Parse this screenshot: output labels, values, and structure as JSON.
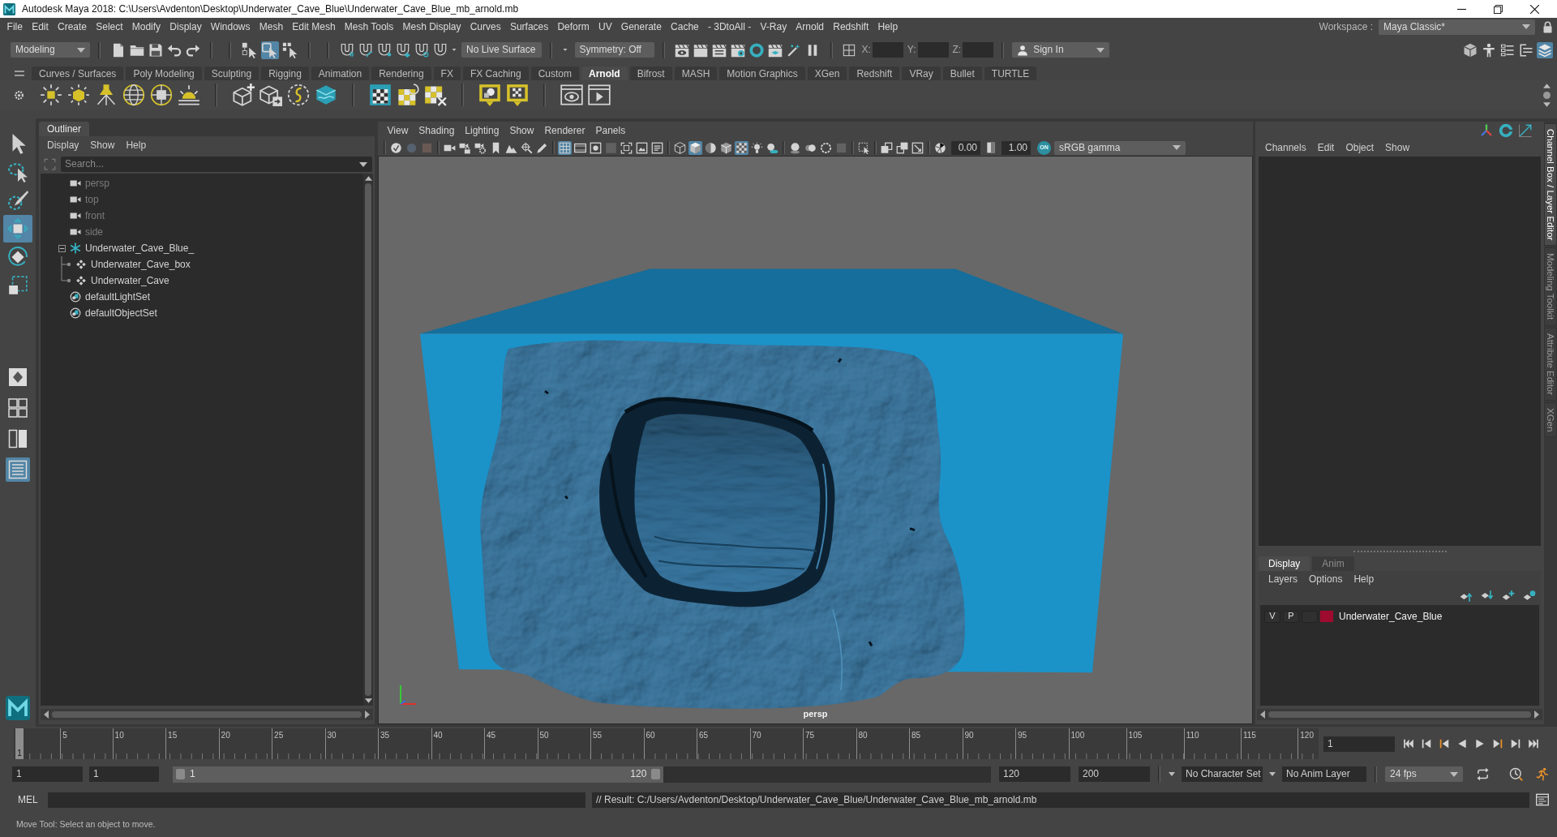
{
  "window": {
    "title": "Autodesk Maya 2018: C:\\Users\\Avdenton\\Desktop\\Underwater_Cave_Blue\\Underwater_Cave_Blue_mb_arnold.mb"
  },
  "menu_bar": {
    "items": [
      "File",
      "Edit",
      "Create",
      "Select",
      "Modify",
      "Display",
      "Windows",
      "Mesh",
      "Edit Mesh",
      "Mesh Tools",
      "Mesh Display",
      "Curves",
      "Surfaces",
      "Deform",
      "UV",
      "Generate",
      "Cache",
      "- 3DtoAll -",
      "V-Ray",
      "Arnold",
      "Redshift",
      "Help"
    ],
    "workspace_label": "Workspace :",
    "workspace": "Maya Classic*"
  },
  "status_line": {
    "menu_set": "Modeling",
    "select_modes": [
      {
        "selected": false
      },
      {
        "selected": true
      },
      {
        "selected": false
      }
    ],
    "live_surface": "No Live Surface",
    "symmetry": "Symmetry: Off",
    "coordinates": [
      {
        "label": "X:"
      },
      {
        "label": "Y:"
      },
      {
        "label": "Z:"
      }
    ],
    "sign_in": "Sign In",
    "panel_toggles": [
      {
        "selected": false
      },
      {
        "selected": false
      },
      {
        "selected": false
      },
      {
        "selected": false
      },
      {
        "selected": true
      }
    ]
  },
  "shelf": {
    "tabs": [
      {
        "label": "Curves / Surfaces",
        "selected": false
      },
      {
        "label": "Poly Modeling",
        "selected": false
      },
      {
        "label": "Sculpting",
        "selected": false
      },
      {
        "label": "Rigging",
        "selected": false
      },
      {
        "label": "Animation",
        "selected": false
      },
      {
        "label": "Rendering",
        "selected": false
      },
      {
        "label": "FX",
        "selected": false
      },
      {
        "label": "FX Caching",
        "selected": false
      },
      {
        "label": "Custom",
        "selected": false
      },
      {
        "label": "Arnold",
        "selected": true
      },
      {
        "label": "Bifrost",
        "selected": false
      },
      {
        "label": "MASH",
        "selected": false
      },
      {
        "label": "Motion Graphics",
        "selected": false
      },
      {
        "label": "XGen",
        "selected": false
      },
      {
        "label": "Redshift",
        "selected": false
      },
      {
        "label": "VRay",
        "selected": false
      },
      {
        "label": "Bullet",
        "selected": false
      },
      {
        "label": "TURTLE",
        "selected": false
      }
    ]
  },
  "toolbox": {
    "tools": [
      {
        "selected": false
      },
      {
        "selected": false
      },
      {
        "selected": false
      },
      {
        "selected": true
      },
      {
        "selected": false
      },
      {
        "selected": false
      }
    ],
    "layouts": [
      {
        "selected": false
      },
      {
        "selected": false
      },
      {
        "selected": false
      },
      {
        "selected": true
      }
    ]
  },
  "outliner": {
    "tab": "Outliner",
    "menus": [
      "Display",
      "Show",
      "Help"
    ],
    "search": {
      "placeholder": "Search..."
    },
    "items": [
      {
        "label": "persp",
        "kind": "camera",
        "dimmed": true,
        "selected": false
      },
      {
        "label": "top",
        "kind": "camera",
        "dimmed": true,
        "selected": false
      },
      {
        "label": "front",
        "kind": "camera",
        "dimmed": true,
        "selected": false
      },
      {
        "label": "side",
        "kind": "camera",
        "dimmed": true,
        "selected": false
      },
      {
        "label": "Underwater_Cave_Blue_",
        "kind": "group",
        "dimmed": false,
        "selected": false,
        "expanded": true,
        "children": [
          {
            "label": "Underwater_Cave_box",
            "kind": "mesh",
            "dimmed": false,
            "selected": false
          },
          {
            "label": "Underwater_Cave",
            "kind": "mesh",
            "dimmed": false,
            "selected": false
          }
        ]
      },
      {
        "label": "defaultLightSet",
        "kind": "set",
        "dimmed": false,
        "selected": false
      },
      {
        "label": "defaultObjectSet",
        "kind": "set",
        "dimmed": false,
        "selected": false
      }
    ]
  },
  "viewport": {
    "menus": [
      "View",
      "Shading",
      "Lighting",
      "Show",
      "Renderer",
      "Panels"
    ],
    "toolbar": [
      {
        "selected": false,
        "disabled": false
      },
      {
        "selected": false,
        "disabled": true
      },
      {
        "selected": false,
        "disabled": true
      },
      {
        "selected": false,
        "disabled": false
      },
      {
        "selected": false,
        "disabled": false
      },
      {
        "selected": false,
        "disabled": false
      },
      {
        "selected": false,
        "disabled": false
      },
      {
        "selected": false,
        "disabled": false
      },
      {
        "selected": false,
        "disabled": false
      },
      {
        "selected": false,
        "disabled": false
      },
      {
        "selected": true,
        "disabled": false
      },
      {
        "selected": false,
        "disabled": false
      },
      {
        "selected": false,
        "disabled": false
      },
      {
        "selected": false,
        "disabled": true
      },
      {
        "selected": false,
        "disabled": false
      },
      {
        "selected": false,
        "disabled": false
      },
      {
        "selected": false,
        "disabled": false
      },
      {
        "selected": false,
        "disabled": false
      },
      {
        "selected": true,
        "disabled": false
      },
      {
        "selected": false,
        "disabled": false
      },
      {
        "selected": false,
        "disabled": false
      },
      {
        "selected": true,
        "disabled": false
      },
      {
        "selected": false,
        "disabled": false
      },
      {
        "selected": false,
        "disabled": false
      },
      {
        "selected": false,
        "disabled": false
      },
      {
        "selected": false,
        "disabled": false
      },
      {
        "selected": false,
        "disabled": false
      },
      {
        "selected": false,
        "disabled": true
      },
      {
        "selected": false,
        "disabled": false
      },
      {
        "selected": false,
        "disabled": false
      },
      {
        "selected": false,
        "disabled": false
      },
      {
        "selected": false,
        "disabled": false
      },
      {
        "selected": false,
        "disabled": false
      }
    ],
    "exposure": "0.00",
    "gamma": "1.00",
    "color_management": "ON",
    "view_transform": "sRGB gamma",
    "camera": "persp"
  },
  "channel_box": {
    "menus": [
      "Channels",
      "Edit",
      "Object",
      "Show"
    ]
  },
  "layer_editor": {
    "tabs": [
      {
        "label": "Display",
        "selected": true
      },
      {
        "label": "Anim",
        "selected": false
      }
    ],
    "menus": [
      "Layers",
      "Options",
      "Help"
    ],
    "layers": [
      {
        "visibility": "V",
        "playback": "P",
        "color": "#9e0b2f",
        "name": "Underwater_Cave_Blue"
      }
    ]
  },
  "side_tabs": [
    {
      "label": "Channel Box / Layer Editor",
      "selected": true
    },
    {
      "label": "Modeling Toolkit",
      "selected": false
    },
    {
      "label": "Attribute Editor",
      "selected": false
    },
    {
      "label": "XGen",
      "selected": false
    }
  ],
  "time_slider": {
    "current_frame": "1",
    "level": 0,
    "ticks": [
      "5",
      "10",
      "15",
      "20",
      "25",
      "30",
      "35",
      "40",
      "45",
      "50",
      "55",
      "60",
      "65",
      "70",
      "75",
      "80",
      "85",
      "90",
      "95",
      "100",
      "105",
      "110",
      "115",
      "120"
    ],
    "frame_field": "1"
  },
  "range_slider": {
    "start": "1",
    "playback_start": "1",
    "handle_start": "1",
    "handle_end": "120",
    "level": 0.6,
    "playback_end": "120",
    "end": "200",
    "character_set": "No Character Set",
    "anim_layer": "No Anim Layer",
    "fps": "24 fps"
  },
  "command_line": {
    "language": "MEL",
    "result": "// Result: C:/Users/Avdenton/Desktop/Underwater_Cave_Blue/Underwater_Cave_Blue_mb_arnold.mb"
  },
  "help_line": "Move Tool: Select an object to move."
}
